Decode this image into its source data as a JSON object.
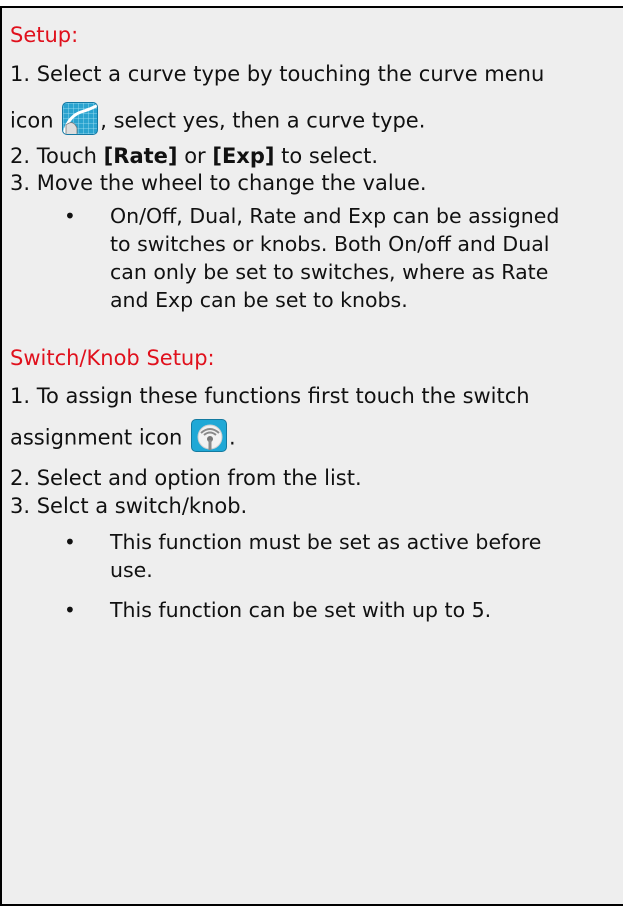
{
  "setup": {
    "heading": "Setup:",
    "step1_line1": "1. Select a curve type by touching the curve menu",
    "step1_prefix": "icon",
    "step1_suffix": ", select yes, then a curve type.",
    "step2_prefix": "2. Touch",
    "step2_rate": "[Rate]",
    "step2_or": "or",
    "step2_exp": "[Exp]",
    "step2_suffix": "to select.",
    "step3": "3. Move the wheel to change the value.",
    "bullet_lines": [
      "On/Off, Dual, Rate and Exp can be assigned",
      "to switches or knobs. Both On/off and Dual",
      "can only be set to switches, where as Rate",
      "and Exp can be set to knobs."
    ],
    "curve_icon": "curve-menu-icon"
  },
  "switch_setup": {
    "heading": "Switch/Knob Setup:",
    "step1_line1": "1. To assign these functions first touch the switch",
    "step1_prefix": "assignment icon",
    "step1_suffix": ".",
    "step2": "2. Select and option from the list.",
    "step3": "3. Selct a switch/knob.",
    "bullet1_lines": [
      "This function must be set as active before",
      "use."
    ],
    "bullet2": "This function can be set with up to 5.",
    "switch_icon": "switch-assignment-icon"
  },
  "bullet_char": "•",
  "colors": {
    "heading": "#e0101c",
    "text": "#111111",
    "panel": "#eeeeee",
    "border": "#000000"
  }
}
